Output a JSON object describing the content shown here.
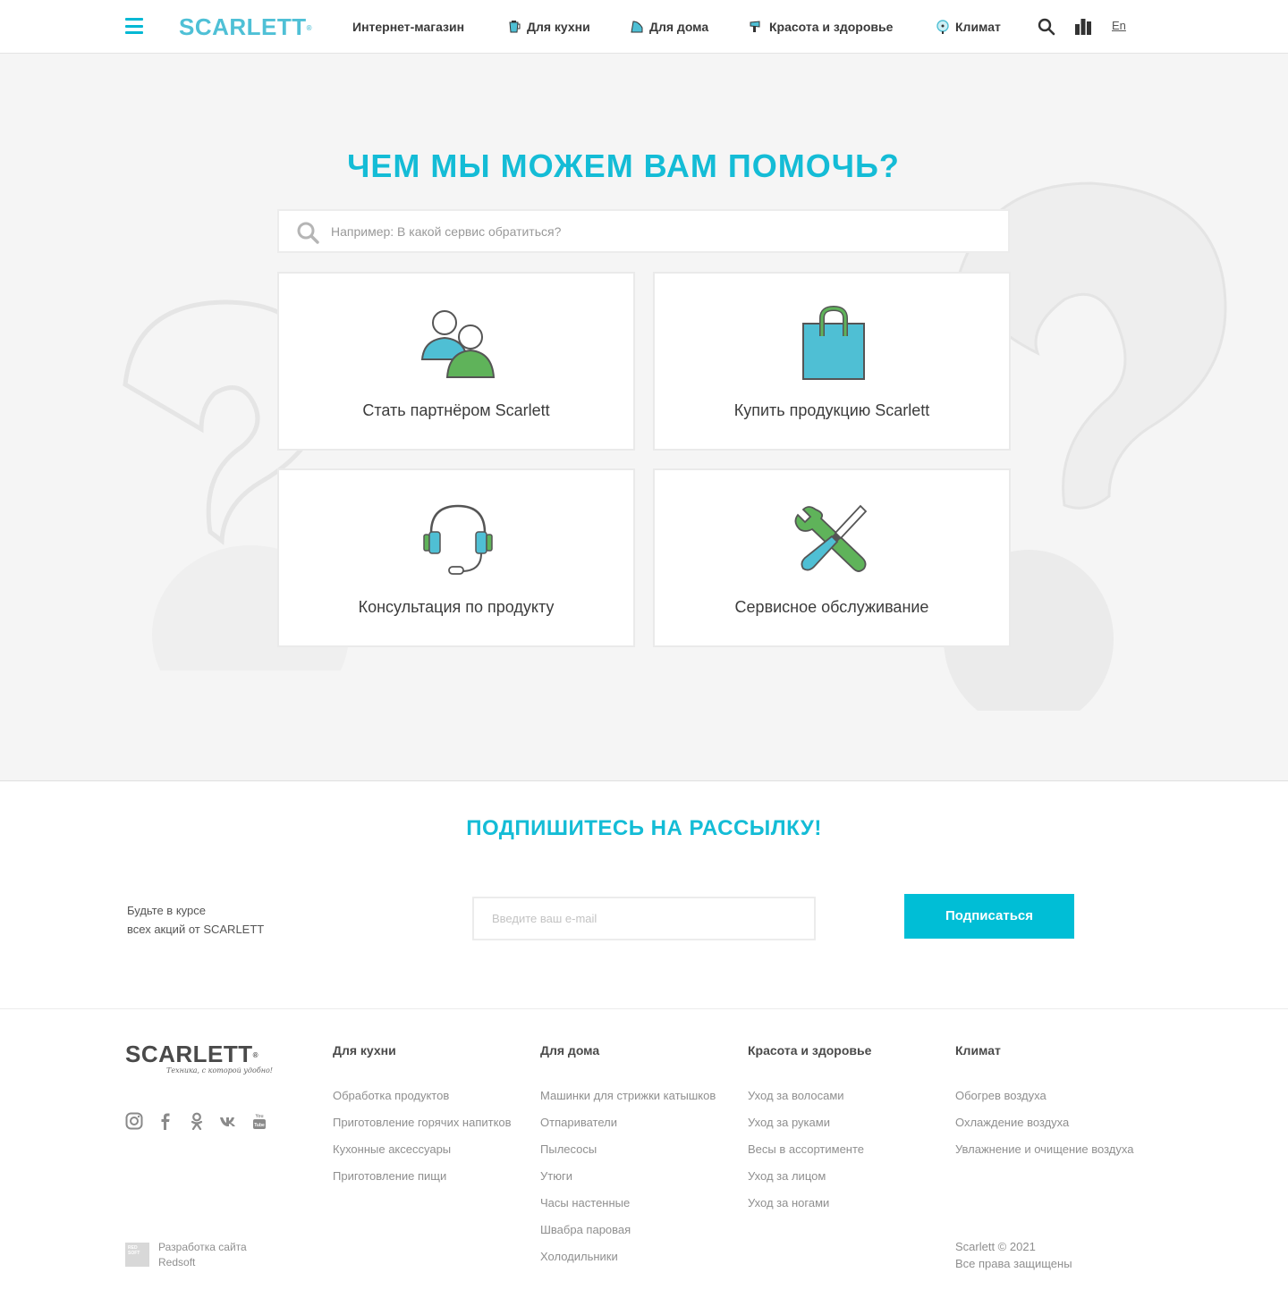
{
  "header": {
    "logo": "SCARLETT",
    "nav": [
      {
        "label": "Интернет-магазин",
        "icon": "none"
      },
      {
        "label": "Для кухни",
        "icon": "kettle-icon"
      },
      {
        "label": "Для дома",
        "icon": "iron-icon"
      },
      {
        "label": "Красота и здоровье",
        "icon": "hairdryer-icon"
      },
      {
        "label": "Климат",
        "icon": "fan-icon"
      }
    ],
    "lang": "En"
  },
  "hero": {
    "title": "ЧЕМ МЫ МОЖЕМ ВАМ ПОМОЧЬ?",
    "search_placeholder": "Например: В какой сервис обратиться?",
    "cards": [
      {
        "label": "Стать партнёром Scarlett",
        "icon": "partners-icon"
      },
      {
        "label": "Купить продукцию Scarlett",
        "icon": "shopping-bag-icon"
      },
      {
        "label": "Консультация по продукту",
        "icon": "headset-icon"
      },
      {
        "label": "Сервисное обслуживание",
        "icon": "tools-icon"
      }
    ]
  },
  "subscribe": {
    "title": "ПОДПИШИТЕСЬ НА РАССЫЛКУ!",
    "text_line1": "Будьте в курсе",
    "text_line2": "всех акций от SCARLETT",
    "email_placeholder": "Введите ваш e-mail",
    "button": "Подписаться"
  },
  "footer": {
    "logo": "SCARLETT",
    "tagline": "Техника, с которой удобно!",
    "social": [
      "instagram-icon",
      "facebook-icon",
      "odnoklassniki-icon",
      "vk-icon",
      "youtube-icon"
    ],
    "columns": [
      {
        "title": "Для кухни",
        "links": [
          "Обработка продуктов",
          "Приготовление горячих напитков",
          "Кухонные аксессуары",
          "Приготовление пищи"
        ]
      },
      {
        "title": "Для дома",
        "links": [
          "Машинки для стрижки катышков",
          "Отпариватели",
          "Пылесосы",
          "Утюги",
          "Часы настенные",
          "Швабра паровая",
          "Холодильники"
        ]
      },
      {
        "title": "Красота и здоровье",
        "links": [
          "Уход за волосами",
          "Уход за руками",
          "Весы в ассортименте",
          "Уход за лицом",
          "Уход за ногами"
        ]
      },
      {
        "title": "Климат",
        "links": [
          "Обогрев воздуха",
          "Охлаждение воздуха",
          "Увлажнение и очищение воздуха"
        ]
      }
    ],
    "dev_logo": "RED SOFT",
    "dev_line1": "Разработка сайта",
    "dev_line2": "Redsoft",
    "copyright_line1": "Scarlett © 2021",
    "copyright_line2": "Все права защищены"
  },
  "colors": {
    "accent": "#00bed6",
    "green": "#5fb35a",
    "blue_icon": "#4fbfd4"
  }
}
